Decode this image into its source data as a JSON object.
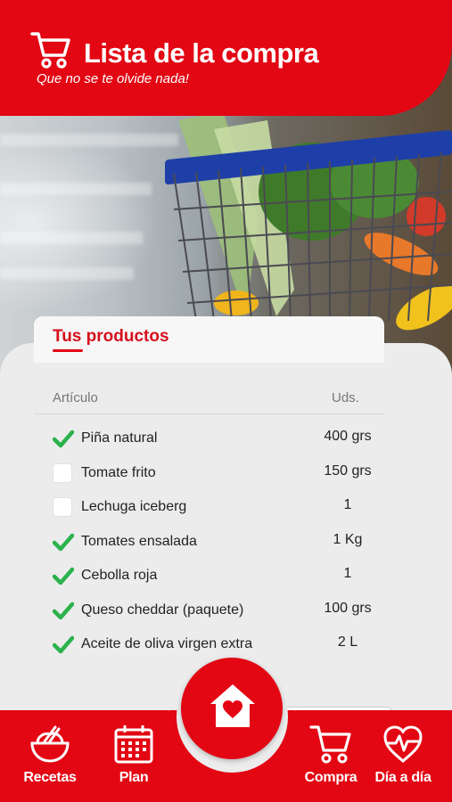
{
  "header": {
    "title": "Lista de la compra",
    "subtitle": "Que no se te olvide nada!",
    "icon": "shopping-cart-icon"
  },
  "products": {
    "tab_title": "Tus productos",
    "columns": {
      "article": "Artículo",
      "units": "Uds."
    },
    "items": [
      {
        "name": "Piña natural",
        "qty": "400 grs",
        "checked": true
      },
      {
        "name": "Tomate frito",
        "qty": "150 grs",
        "checked": false
      },
      {
        "name": "Lechuga iceberg",
        "qty": "1",
        "checked": false
      },
      {
        "name": "Tomates ensalada",
        "qty": "1 Kg",
        "checked": true
      },
      {
        "name": "Cebolla roja",
        "qty": "1",
        "checked": true
      },
      {
        "name": "Queso cheddar (paquete)",
        "qty": "100 grs",
        "checked": true
      },
      {
        "name": "Aceite de oliva virgen extra",
        "qty": "2 L",
        "checked": true
      }
    ]
  },
  "nav": {
    "recetas": "Recetas",
    "plan": "Plan",
    "home_icon": "home-heart-icon",
    "compra": "Compra",
    "dia": "Día a día"
  },
  "colors": {
    "brand_red": "#e30613",
    "check_green": "#2bb24c"
  }
}
